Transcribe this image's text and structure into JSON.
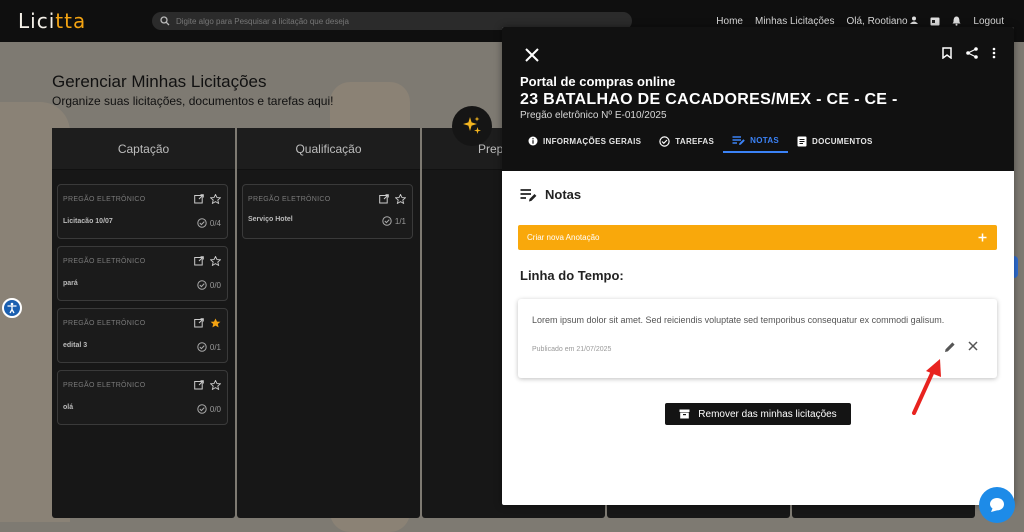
{
  "app": {
    "logo_main": "Lici",
    "logo_accent": "tta"
  },
  "search": {
    "placeholder": "Digite algo para Pesquisar a licitação que deseja"
  },
  "nav": {
    "home": "Home",
    "my_bids": "Minhas Licitações",
    "greeting": "Olá, Rootiano",
    "logout": "Logout"
  },
  "page": {
    "title": "Gerenciar Minhas Licitações",
    "subtitle": "Organize suas licitações, documentos e tarefas aqui!"
  },
  "columns": [
    {
      "title": "Captação",
      "cards": [
        {
          "type": "PREGÃO ELETRÔNICO",
          "name": "Licitacão 10/07",
          "count": "0/4",
          "starred": false
        },
        {
          "type": "PREGÃO ELETRÔNICO",
          "name": "pará",
          "count": "0/0",
          "starred": false
        },
        {
          "type": "PREGÃO ELETRÔNICO",
          "name": "edital 3",
          "count": "0/1",
          "starred": true
        },
        {
          "type": "PREGÃO ELETRÔNICO",
          "name": "olá",
          "count": "0/0",
          "starred": false
        }
      ]
    },
    {
      "title": "Qualificação",
      "cards": [
        {
          "type": "PREGÃO ELETRÔNICO",
          "name": "Serviço Hotel",
          "count": "1/1",
          "starred": false
        }
      ]
    },
    {
      "title": "Prep",
      "cards": []
    }
  ],
  "modal": {
    "portal": "Portal de compras online",
    "org": "23 BATALHAO DE CACADORES/MEX - CE - CE -",
    "pregao": "Pregão eletrônico Nº E-010/2025",
    "tabs": [
      {
        "label": "INFORMAÇÕES GERAIS",
        "icon": "info-icon"
      },
      {
        "label": "TAREFAS",
        "icon": "check-circle-icon"
      },
      {
        "label": "NOTAS",
        "icon": "notes-icon",
        "active": true
      },
      {
        "label": "DOCUMENTOS",
        "icon": "document-icon"
      }
    ],
    "notes_title": "Notas",
    "create_note": "Criar nova Anotação",
    "timeline_title": "Linha do Tempo:",
    "note": {
      "text": "Lorem ipsum dolor sit amet. Sed reiciendis voluptate sed temporibus consequatur ex commodi galisum.",
      "date": "Publicado em 21/07/2025"
    },
    "remove_button": "Remover das minhas licitações"
  },
  "colors": {
    "accent": "#f9a80b",
    "tab_active": "#3b82f6",
    "arrow": "#e8231f",
    "star": "#f3a312"
  }
}
